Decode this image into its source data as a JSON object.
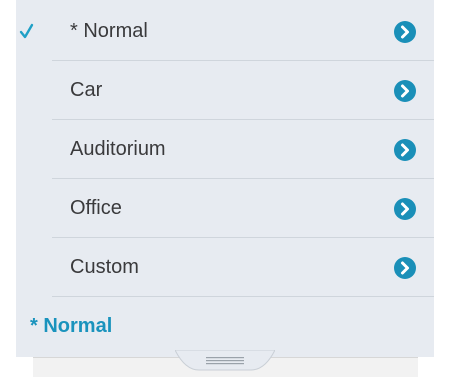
{
  "colors": {
    "accent": "#1fa0c6",
    "panel_bg": "#e7ebf1",
    "text": "#3a3a3c",
    "footer_text": "#1a93bd"
  },
  "options": [
    {
      "label": "* Normal",
      "selected": true,
      "icon": "chevron-right-circle-icon"
    },
    {
      "label": "Car",
      "selected": false,
      "icon": "chevron-right-circle-icon"
    },
    {
      "label": "Auditorium",
      "selected": false,
      "icon": "chevron-right-circle-icon"
    },
    {
      "label": "Office",
      "selected": false,
      "icon": "chevron-right-circle-icon"
    },
    {
      "label": "Custom",
      "selected": false,
      "icon": "chevron-right-circle-icon"
    }
  ],
  "check_icon": "checkmark-icon",
  "footer": {
    "current_preset": "* Normal"
  },
  "grabber_icon": "drag-handle-icon"
}
